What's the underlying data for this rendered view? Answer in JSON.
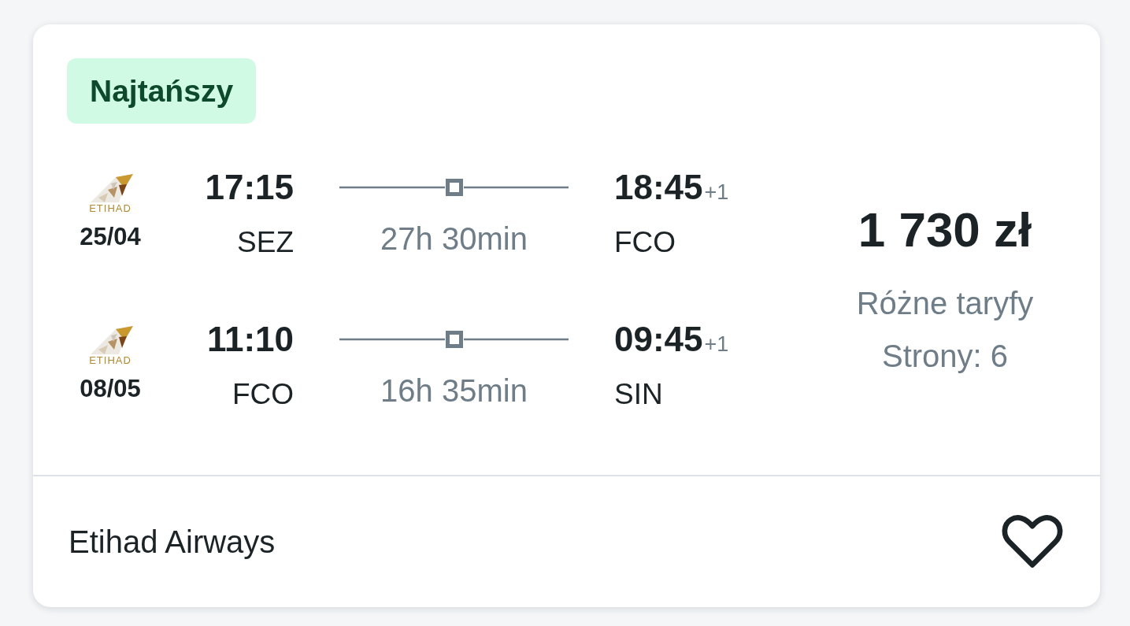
{
  "badge": {
    "label": "Najtańszy"
  },
  "legs": [
    {
      "logo_text": "ETIHAD",
      "date": "25/04",
      "departure": {
        "time": "17:15",
        "airport": "SEZ"
      },
      "duration": "27h 30min",
      "arrival": {
        "time": "18:45",
        "day_offset": "+1",
        "airport": "FCO"
      }
    },
    {
      "logo_text": "ETIHAD",
      "date": "08/05",
      "departure": {
        "time": "11:10",
        "airport": "FCO"
      },
      "duration": "16h 35min",
      "arrival": {
        "time": "09:45",
        "day_offset": "+1",
        "airport": "SIN"
      }
    }
  ],
  "price": {
    "amount": "1 730 zł",
    "fare_note": "Różne taryfy",
    "sites": "Strony: 6"
  },
  "footer": {
    "airline": "Etihad Airways",
    "saved": false
  }
}
